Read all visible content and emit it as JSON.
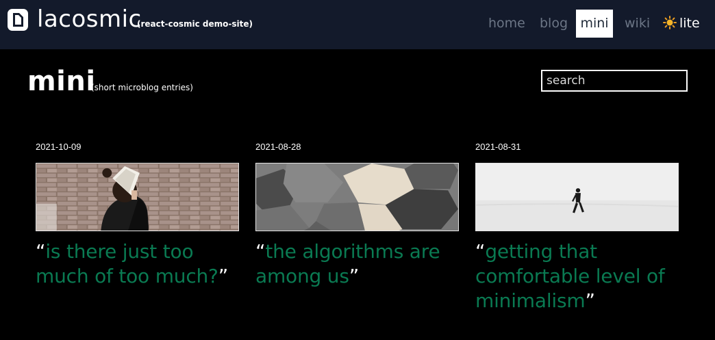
{
  "header": {
    "brand": "lacosmic",
    "brand_subtitle": "(react-cosmic demo-site)",
    "nav": {
      "home": "home",
      "blog": "blog",
      "mini": "mini",
      "wiki": "wiki"
    },
    "theme_toggle": "lite",
    "active_nav": "mini"
  },
  "page": {
    "title": "mini",
    "subtitle": "(short microblog entries)",
    "search_placeholder": "search"
  },
  "posts": [
    {
      "date": "2021-10-09",
      "quote": "is there just too much of too much?",
      "image": "woman-book-brick-wall"
    },
    {
      "date": "2021-08-28",
      "quote": "the algorithms are among us",
      "image": "hexagon-tiles"
    },
    {
      "date": "2021-08-31",
      "quote": "getting that comfortable level of minimalism",
      "image": "person-walking-snow"
    }
  ],
  "colors": {
    "topbar": "#131a2b",
    "background": "#000000",
    "accent_green": "#0a7a52",
    "nav_inactive": "#6c7686"
  },
  "quote_open": "“",
  "quote_close": "”"
}
